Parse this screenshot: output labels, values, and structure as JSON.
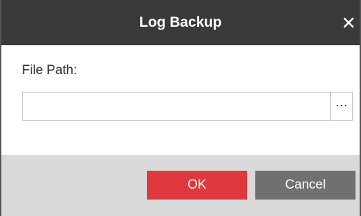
{
  "dialog": {
    "title": "Log Backup",
    "close_icon": "close-icon",
    "file_path_label": "File Path:",
    "file_path_value": "",
    "browse_label": "···",
    "ok_label": "OK",
    "cancel_label": "Cancel"
  },
  "colors": {
    "titlebar": "#3a3a3a",
    "ok_button": "#e0383e",
    "cancel_button": "#707070",
    "footer": "#d9d9d9"
  }
}
